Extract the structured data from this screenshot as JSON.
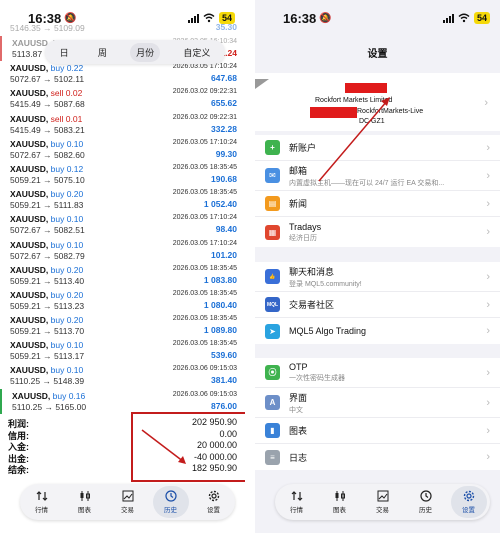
{
  "status": {
    "time": "16:38",
    "battery": "54"
  },
  "left": {
    "period_tabs": [
      {
        "label": "日",
        "active": false
      },
      {
        "label": "周",
        "active": false
      },
      {
        "label": "月份",
        "active": true
      },
      {
        "label": "自定义",
        "active": false
      }
    ],
    "top_fragment": {
      "a_prices": "5146.35 → 5109.09",
      "a_profit": "35.30",
      "b_sym": "XAUUSD, buy 0.01",
      "b_date": "2026.03.05 16:10:34",
      "b_prices": "5113.87 → 5113.87",
      "b_profit": "-1 241.24"
    },
    "deals": [
      {
        "sym": "XAUUSD,",
        "dir": "buy 0.22",
        "type": "buy",
        "date": "2026.03.05 17:10:24",
        "prices": "5072.67 → 5102.11",
        "profit": "647.68"
      },
      {
        "sym": "XAUUSD,",
        "dir": "sell 0.02",
        "type": "sell",
        "date": "2026.03.02 09:22:31",
        "prices": "5415.49 → 5087.68",
        "profit": "655.62"
      },
      {
        "sym": "XAUUSD,",
        "dir": "sell 0.01",
        "type": "sell",
        "date": "2026.03.02 09:22:31",
        "prices": "5415.49 → 5083.21",
        "profit": "332.28"
      },
      {
        "sym": "XAUUSD,",
        "dir": "buy 0.10",
        "type": "buy",
        "date": "2026.03.05 17:10:24",
        "prices": "5072.67 → 5082.60",
        "profit": "99.30"
      },
      {
        "sym": "XAUUSD,",
        "dir": "buy 0.12",
        "type": "buy",
        "date": "2026.03.05 18:35:45",
        "prices": "5059.21 → 5075.10",
        "profit": "190.68"
      },
      {
        "sym": "XAUUSD,",
        "dir": "buy 0.20",
        "type": "buy",
        "date": "2026.03.05 18:35:45",
        "prices": "5059.21 → 5111.83",
        "profit": "1 052.40"
      },
      {
        "sym": "XAUUSD,",
        "dir": "buy 0.10",
        "type": "buy",
        "date": "2026.03.05 17:10:24",
        "prices": "5072.67 → 5082.51",
        "profit": "98.40"
      },
      {
        "sym": "XAUUSD,",
        "dir": "buy 0.10",
        "type": "buy",
        "date": "2026.03.05 17:10:24",
        "prices": "5072.67 → 5082.79",
        "profit": "101.20"
      },
      {
        "sym": "XAUUSD,",
        "dir": "buy 0.20",
        "type": "buy",
        "date": "2026.03.05 18:35:45",
        "prices": "5059.21 → 5113.40",
        "profit": "1 083.80"
      },
      {
        "sym": "XAUUSD,",
        "dir": "buy 0.20",
        "type": "buy",
        "date": "2026.03.05 18:35:45",
        "prices": "5059.21 → 5113.23",
        "profit": "1 080.40"
      },
      {
        "sym": "XAUUSD,",
        "dir": "buy 0.20",
        "type": "buy",
        "date": "2026.03.05 18:35:45",
        "prices": "5059.21 → 5113.70",
        "profit": "1 089.80"
      },
      {
        "sym": "XAUUSD,",
        "dir": "buy 0.10",
        "type": "buy",
        "date": "2026.03.05 18:35:45",
        "prices": "5059.21 → 5113.17",
        "profit": "539.60"
      },
      {
        "sym": "XAUUSD,",
        "dir": "buy 0.10",
        "type": "buy",
        "date": "2026.03.06 09:15:03",
        "prices": "5110.25 → 5148.39",
        "profit": "381.40"
      },
      {
        "sym": "XAUUSD,",
        "dir": "buy 0.16",
        "type": "buy",
        "date": "2026.03.06 09:15:03",
        "prices": "5110.25 → 5165.00",
        "profit": "876.00"
      }
    ],
    "summary": [
      {
        "label": "利润:",
        "value": "202 950.90"
      },
      {
        "label": "信用:",
        "value": "0.00"
      },
      {
        "label": "入金:",
        "value": "20 000.00"
      },
      {
        "label": "出金:",
        "value": "-40 000.00"
      },
      {
        "label": "结余:",
        "value": "182 950.90"
      }
    ],
    "tabs": [
      {
        "label": "行情",
        "icon": "sort-arrows-icon",
        "active": false
      },
      {
        "label": "图表",
        "icon": "candlestick-icon",
        "active": false
      },
      {
        "label": "交易",
        "icon": "trade-chart-icon",
        "active": false
      },
      {
        "label": "历史",
        "icon": "history-clock-icon",
        "active": true
      },
      {
        "label": "设置",
        "icon": "gear-icon",
        "active": false
      }
    ]
  },
  "right": {
    "title": "设置",
    "account": {
      "broker": "Rockfort Markets Limited",
      "server": "RockfortMarkets-Live",
      "extra": "DC GZ1"
    },
    "group1": [
      {
        "label": "新账户",
        "sub": "",
        "icon": "new-account-icon",
        "color": "#3fb34f",
        "glyph": "+"
      },
      {
        "label": "邮箱",
        "sub": "内置虚拟主机——现在可以 24/7 运行 EA 交易和...",
        "icon": "mail-icon",
        "color": "#4a90e2",
        "glyph": "✉"
      },
      {
        "label": "新闻",
        "sub": "",
        "icon": "news-book-icon",
        "color": "#f39a1e",
        "glyph": "▤"
      },
      {
        "label": "Tradays",
        "sub": "经济日历",
        "icon": "tradays-calendar-icon",
        "color": "#e0472f",
        "glyph": "▦"
      }
    ],
    "group2": [
      {
        "label": "聊天和消息",
        "sub": "登录 MQL5.community!",
        "icon": "chat-thumb-icon",
        "color": "#3a6fd8",
        "glyph": "👍"
      },
      {
        "label": "交易者社区",
        "sub": "",
        "icon": "mql5-community-icon",
        "color": "#3466c8",
        "glyph": "MQL"
      },
      {
        "label": "MQL5 Algo Trading",
        "sub": "",
        "icon": "telegram-icon",
        "color": "#2aa3e0",
        "glyph": "➤"
      }
    ],
    "group3": [
      {
        "label": "OTP",
        "sub": "一次性密码生成器",
        "icon": "otp-icon",
        "color": "#3fb34f",
        "glyph": "⦿"
      },
      {
        "label": "界面",
        "sub": "中文",
        "icon": "language-icon",
        "color": "#6d8fc8",
        "glyph": "A"
      },
      {
        "label": "图表",
        "sub": "",
        "icon": "chart-settings-icon",
        "color": "#3a82d8",
        "glyph": "▮"
      },
      {
        "label": "日志",
        "sub": "",
        "icon": "journal-icon",
        "color": "#9aa3ad",
        "glyph": "≡"
      }
    ],
    "tabs": [
      {
        "label": "行情",
        "icon": "sort-arrows-icon",
        "active": false
      },
      {
        "label": "图表",
        "icon": "candlestick-icon",
        "active": false
      },
      {
        "label": "交易",
        "icon": "trade-chart-icon",
        "active": false
      },
      {
        "label": "历史",
        "icon": "history-clock-icon",
        "active": false
      },
      {
        "label": "设置",
        "icon": "gear-icon",
        "active": true
      }
    ]
  }
}
